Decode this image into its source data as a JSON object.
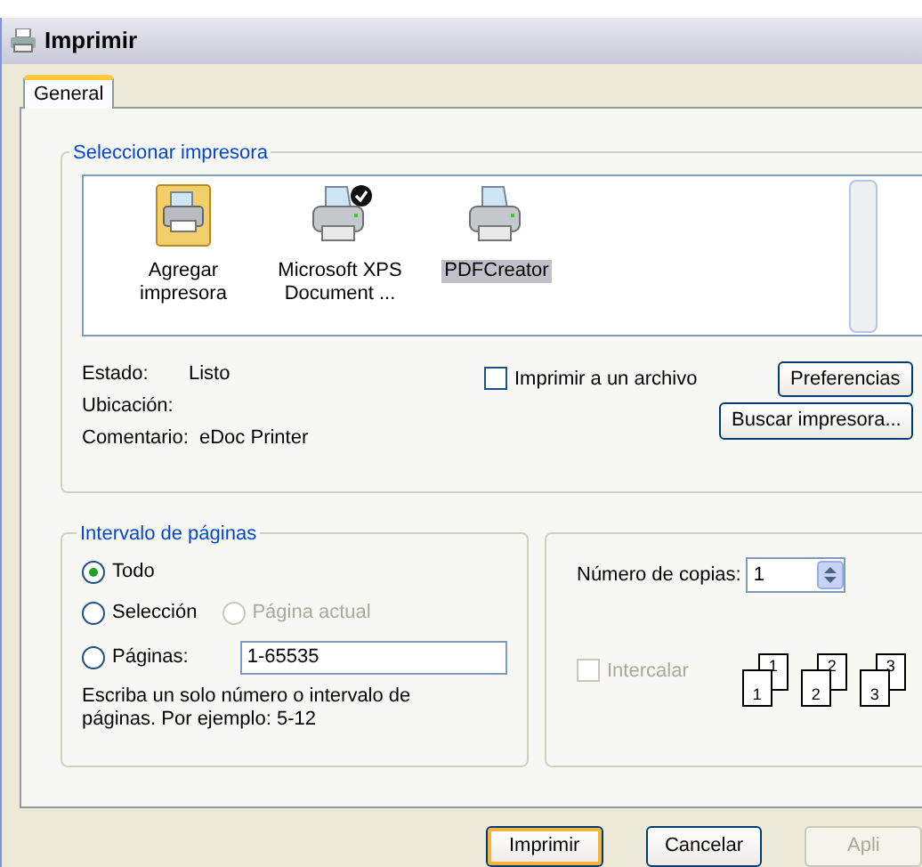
{
  "window": {
    "title": "Imprimir"
  },
  "tabs": [
    {
      "label": "General",
      "selected": true
    }
  ],
  "printer_group": {
    "title": "Seleccionar impresora",
    "printers": [
      {
        "kind": "add",
        "label": "Agregar impresora",
        "selected": false
      },
      {
        "kind": "printer",
        "label": "Microsoft XPS Document ...",
        "selected": false,
        "default": true
      },
      {
        "kind": "printer",
        "label": "PDFCreator",
        "selected": true,
        "default": false
      }
    ],
    "status_label": "Estado:",
    "status": "Listo",
    "location_label": "Ubicación:",
    "comment_label": "Comentario:",
    "comment": "eDoc Printer",
    "print_to_file": {
      "label": "Imprimir a un archivo",
      "checked": false
    },
    "preferences_button": "Preferencias",
    "find_button": "Buscar impresora..."
  },
  "range_group": {
    "title": "Intervalo de páginas",
    "options": [
      {
        "label": "Todo",
        "selected": true,
        "disabled": false
      },
      {
        "label": "Selección",
        "selected": false,
        "disabled": false
      },
      {
        "label": "Página actual",
        "selected": false,
        "disabled": true
      },
      {
        "label": "Páginas:",
        "selected": false,
        "disabled": false
      }
    ],
    "pages_value": "1-65535",
    "hint": "Escriba un solo número o intervalo de páginas. Por ejemplo: 5-12"
  },
  "copies_group": {
    "copies_label": "Número de copias:",
    "copies_value": "1",
    "collate": {
      "label": "Intercalar",
      "checked": false,
      "disabled": true
    },
    "collate_pages": [
      "1",
      "1",
      "2",
      "2",
      "3",
      "3"
    ]
  },
  "buttons": [
    {
      "label": "Imprimir",
      "default": true,
      "disabled": false
    },
    {
      "label": "Cancelar",
      "default": false,
      "disabled": false
    },
    {
      "label": "Apli",
      "default": false,
      "disabled": true
    }
  ]
}
